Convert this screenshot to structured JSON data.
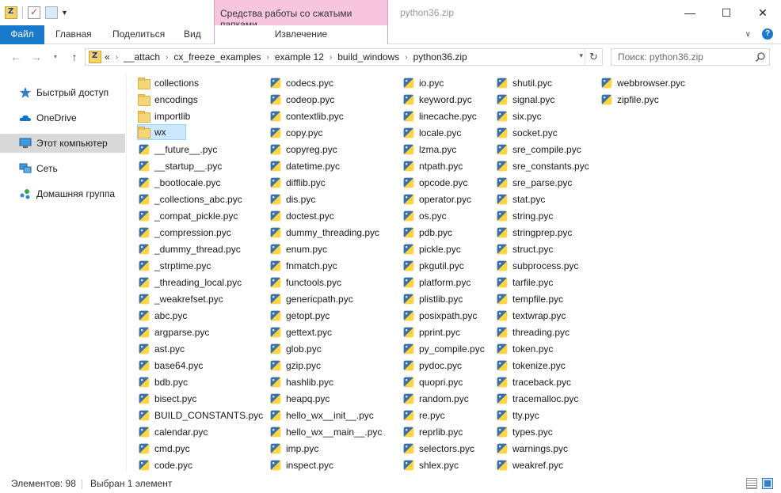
{
  "window": {
    "title": "python36.zip",
    "context_tab_title": "Средства работы со сжатыми папками",
    "controls": {
      "minimize": "—",
      "maximize": "☐",
      "close": "✕"
    }
  },
  "ribbon": {
    "tabs": {
      "file": "Файл",
      "home": "Главная",
      "share": "Поделиться",
      "view": "Вид",
      "extract": "Извлечение"
    }
  },
  "address": {
    "overflow": "«",
    "crumbs": [
      "__attach",
      "cx_freeze_examples",
      "example 12",
      "build_windows",
      "python36.zip"
    ]
  },
  "search": {
    "placeholder": "Поиск: python36.zip"
  },
  "navpane": {
    "items": [
      {
        "label": "Быстрый доступ",
        "icon": "star-icon"
      },
      {
        "label": "OneDrive",
        "icon": "cloud-icon"
      },
      {
        "label": "Этот компьютер",
        "icon": "computer-icon",
        "selected": true
      },
      {
        "label": "Сеть",
        "icon": "network-icon"
      },
      {
        "label": "Домашняя группа",
        "icon": "homegroup-icon"
      }
    ]
  },
  "files": {
    "columns": [
      [
        {
          "name": "collections",
          "type": "folder"
        },
        {
          "name": "encodings",
          "type": "folder"
        },
        {
          "name": "importlib",
          "type": "folder"
        },
        {
          "name": "wx",
          "type": "folder",
          "selected": true
        },
        {
          "name": "__future__.pyc",
          "type": "pyc"
        },
        {
          "name": "__startup__.pyc",
          "type": "pyc"
        },
        {
          "name": "_bootlocale.pyc",
          "type": "pyc"
        },
        {
          "name": "_collections_abc.pyc",
          "type": "pyc"
        },
        {
          "name": "_compat_pickle.pyc",
          "type": "pyc"
        },
        {
          "name": "_compression.pyc",
          "type": "pyc"
        },
        {
          "name": "_dummy_thread.pyc",
          "type": "pyc"
        },
        {
          "name": "_strptime.pyc",
          "type": "pyc"
        },
        {
          "name": "_threading_local.pyc",
          "type": "pyc"
        },
        {
          "name": "_weakrefset.pyc",
          "type": "pyc"
        },
        {
          "name": "abc.pyc",
          "type": "pyc"
        },
        {
          "name": "argparse.pyc",
          "type": "pyc"
        },
        {
          "name": "ast.pyc",
          "type": "pyc"
        },
        {
          "name": "base64.pyc",
          "type": "pyc"
        },
        {
          "name": "bdb.pyc",
          "type": "pyc"
        },
        {
          "name": "bisect.pyc",
          "type": "pyc"
        },
        {
          "name": "BUILD_CONSTANTS.pyc",
          "type": "pyc"
        },
        {
          "name": "calendar.pyc",
          "type": "pyc"
        },
        {
          "name": "cmd.pyc",
          "type": "pyc"
        },
        {
          "name": "code.pyc",
          "type": "pyc"
        }
      ],
      [
        {
          "name": "codecs.pyc",
          "type": "pyc"
        },
        {
          "name": "codeop.pyc",
          "type": "pyc"
        },
        {
          "name": "contextlib.pyc",
          "type": "pyc"
        },
        {
          "name": "copy.pyc",
          "type": "pyc"
        },
        {
          "name": "copyreg.pyc",
          "type": "pyc"
        },
        {
          "name": "datetime.pyc",
          "type": "pyc"
        },
        {
          "name": "difflib.pyc",
          "type": "pyc"
        },
        {
          "name": "dis.pyc",
          "type": "pyc"
        },
        {
          "name": "doctest.pyc",
          "type": "pyc"
        },
        {
          "name": "dummy_threading.pyc",
          "type": "pyc"
        },
        {
          "name": "enum.pyc",
          "type": "pyc"
        },
        {
          "name": "fnmatch.pyc",
          "type": "pyc"
        },
        {
          "name": "functools.pyc",
          "type": "pyc"
        },
        {
          "name": "genericpath.pyc",
          "type": "pyc"
        },
        {
          "name": "getopt.pyc",
          "type": "pyc"
        },
        {
          "name": "gettext.pyc",
          "type": "pyc"
        },
        {
          "name": "glob.pyc",
          "type": "pyc"
        },
        {
          "name": "gzip.pyc",
          "type": "pyc"
        },
        {
          "name": "hashlib.pyc",
          "type": "pyc"
        },
        {
          "name": "heapq.pyc",
          "type": "pyc"
        },
        {
          "name": "hello_wx__init__.pyc",
          "type": "pyc"
        },
        {
          "name": "hello_wx__main__.pyc",
          "type": "pyc"
        },
        {
          "name": "imp.pyc",
          "type": "pyc"
        },
        {
          "name": "inspect.pyc",
          "type": "pyc"
        }
      ],
      [
        {
          "name": "io.pyc",
          "type": "pyc"
        },
        {
          "name": "keyword.pyc",
          "type": "pyc"
        },
        {
          "name": "linecache.pyc",
          "type": "pyc"
        },
        {
          "name": "locale.pyc",
          "type": "pyc"
        },
        {
          "name": "lzma.pyc",
          "type": "pyc"
        },
        {
          "name": "ntpath.pyc",
          "type": "pyc"
        },
        {
          "name": "opcode.pyc",
          "type": "pyc"
        },
        {
          "name": "operator.pyc",
          "type": "pyc"
        },
        {
          "name": "os.pyc",
          "type": "pyc"
        },
        {
          "name": "pdb.pyc",
          "type": "pyc"
        },
        {
          "name": "pickle.pyc",
          "type": "pyc"
        },
        {
          "name": "pkgutil.pyc",
          "type": "pyc"
        },
        {
          "name": "platform.pyc",
          "type": "pyc"
        },
        {
          "name": "plistlib.pyc",
          "type": "pyc"
        },
        {
          "name": "posixpath.pyc",
          "type": "pyc"
        },
        {
          "name": "pprint.pyc",
          "type": "pyc"
        },
        {
          "name": "py_compile.pyc",
          "type": "pyc"
        },
        {
          "name": "pydoc.pyc",
          "type": "pyc"
        },
        {
          "name": "quopri.pyc",
          "type": "pyc"
        },
        {
          "name": "random.pyc",
          "type": "pyc"
        },
        {
          "name": "re.pyc",
          "type": "pyc"
        },
        {
          "name": "reprlib.pyc",
          "type": "pyc"
        },
        {
          "name": "selectors.pyc",
          "type": "pyc"
        },
        {
          "name": "shlex.pyc",
          "type": "pyc"
        }
      ],
      [
        {
          "name": "shutil.pyc",
          "type": "pyc"
        },
        {
          "name": "signal.pyc",
          "type": "pyc"
        },
        {
          "name": "six.pyc",
          "type": "pyc"
        },
        {
          "name": "socket.pyc",
          "type": "pyc"
        },
        {
          "name": "sre_compile.pyc",
          "type": "pyc"
        },
        {
          "name": "sre_constants.pyc",
          "type": "pyc"
        },
        {
          "name": "sre_parse.pyc",
          "type": "pyc"
        },
        {
          "name": "stat.pyc",
          "type": "pyc"
        },
        {
          "name": "string.pyc",
          "type": "pyc"
        },
        {
          "name": "stringprep.pyc",
          "type": "pyc"
        },
        {
          "name": "struct.pyc",
          "type": "pyc"
        },
        {
          "name": "subprocess.pyc",
          "type": "pyc"
        },
        {
          "name": "tarfile.pyc",
          "type": "pyc"
        },
        {
          "name": "tempfile.pyc",
          "type": "pyc"
        },
        {
          "name": "textwrap.pyc",
          "type": "pyc"
        },
        {
          "name": "threading.pyc",
          "type": "pyc"
        },
        {
          "name": "token.pyc",
          "type": "pyc"
        },
        {
          "name": "tokenize.pyc",
          "type": "pyc"
        },
        {
          "name": "traceback.pyc",
          "type": "pyc"
        },
        {
          "name": "tracemalloc.pyc",
          "type": "pyc"
        },
        {
          "name": "tty.pyc",
          "type": "pyc"
        },
        {
          "name": "types.pyc",
          "type": "pyc"
        },
        {
          "name": "warnings.pyc",
          "type": "pyc"
        },
        {
          "name": "weakref.pyc",
          "type": "pyc"
        }
      ],
      [
        {
          "name": "webbrowser.pyc",
          "type": "pyc"
        },
        {
          "name": "zipfile.pyc",
          "type": "pyc"
        }
      ]
    ]
  },
  "status": {
    "count": "Элементов: 98",
    "selection": "Выбран 1 элемент"
  },
  "colors": {
    "accent": "#1979ca",
    "context_tab": "#f7c6de",
    "selection": "#cce8ff"
  }
}
